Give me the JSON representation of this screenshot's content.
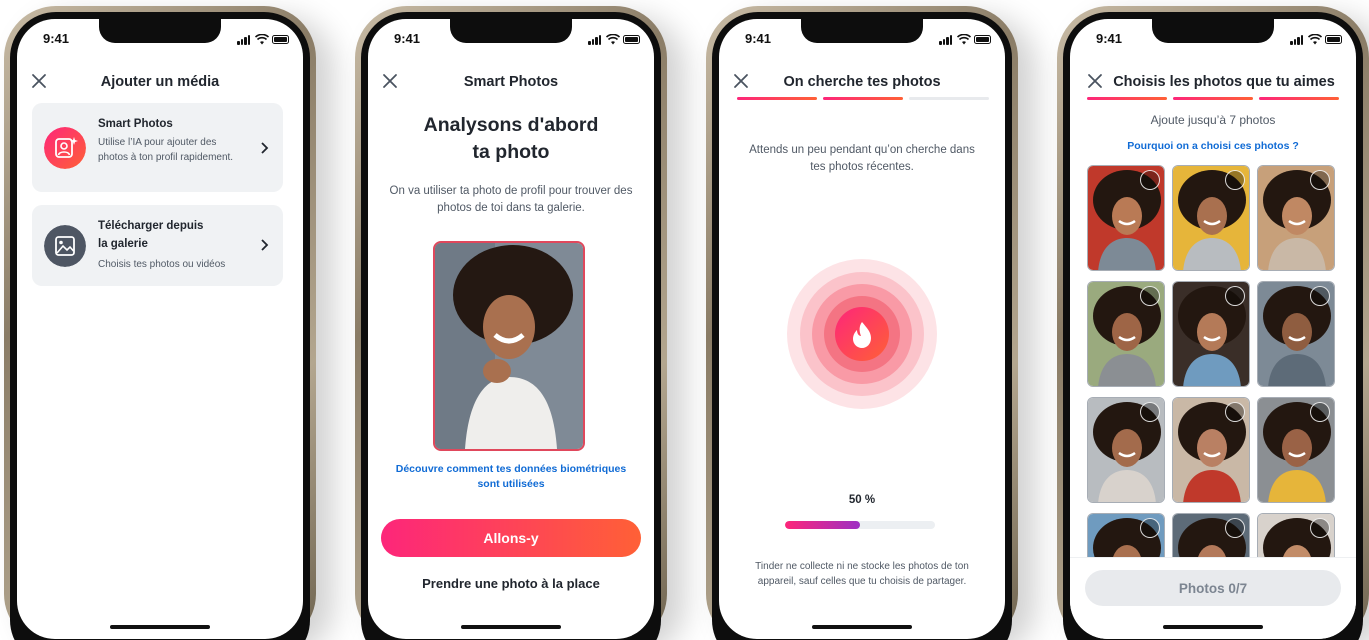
{
  "status": {
    "time": "9:41"
  },
  "screen1": {
    "title": "Ajouter un média",
    "smart": {
      "title": "Smart Photos",
      "desc": "Utilise l’IA pour ajouter des photos à ton profil rapidement."
    },
    "gallery": {
      "title": "Télécharger depuis\nla galerie",
      "desc": "Choisis tes photos ou vidéos"
    }
  },
  "screen2": {
    "title": "Smart Photos",
    "heading": "Analysons d'abord\nta photo",
    "body": "On va utiliser ta photo de profil pour trouver des photos de toi dans ta galerie.",
    "link": "Découvre comment tes données biométriques sont utilisées",
    "cta": "Allons-y",
    "alt": "Prendre une photo à la place"
  },
  "screen3": {
    "title": "On cherche tes photos",
    "body": "Attends un peu pendant qu’on cherche dans tes photos récentes.",
    "percent_label": "50 %",
    "progress": 0.5,
    "footer": "Tinder ne collecte ni ne stocke les photos de ton appareil, sauf celles que tu choisis de partager."
  },
  "screen4": {
    "title": "Choisis les photos que tu aimes",
    "subtitle": "Ajoute jusqu’à 7 photos",
    "link": "Pourquoi on a choisi ces photos ?",
    "button": "Photos 0/7"
  },
  "colors": {
    "brand_start": "#fd267a",
    "brand_end": "#ff6036",
    "link": "#106bd5"
  },
  "icons": [
    "close-icon",
    "chevron-right-icon",
    "smart-photo-icon",
    "gallery-icon",
    "flame-icon"
  ]
}
